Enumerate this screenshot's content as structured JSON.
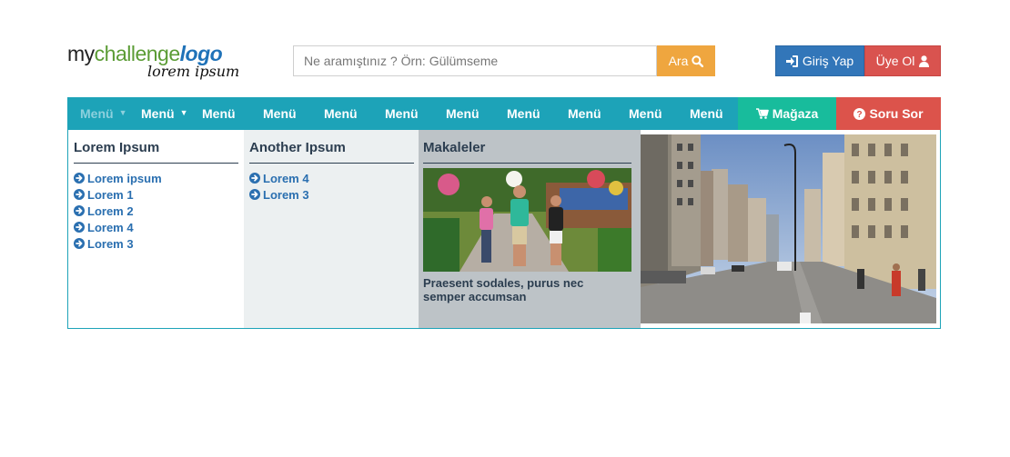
{
  "logo": {
    "part1": "my",
    "part2": "challenge",
    "part3": "logo",
    "tagline": "lorem ipsum"
  },
  "search": {
    "placeholder": "Ne aramıştınız ? Örn: Gülümseme",
    "button_label": "Ara",
    "button_icon": "search-icon"
  },
  "auth": {
    "login_label": "Giriş Yap",
    "login_icon": "sign-in-icon",
    "register_label": "Üye Ol",
    "register_icon": "user-icon"
  },
  "nav": {
    "items": [
      {
        "label": "Menü",
        "caret": true,
        "active": true
      },
      {
        "label": "Menü",
        "caret": true
      },
      {
        "label": "Menü"
      },
      {
        "label": "Menü"
      },
      {
        "label": "Menü"
      },
      {
        "label": "Menü"
      },
      {
        "label": "Menü"
      },
      {
        "label": "Menü"
      },
      {
        "label": "Menü"
      },
      {
        "label": "Menü"
      },
      {
        "label": "Menü"
      }
    ],
    "shop_label": "Mağaza",
    "shop_icon": "cart-icon",
    "ask_label": "Soru Sor",
    "ask_icon": "question-icon"
  },
  "dropdown": {
    "col1": {
      "title": "Lorem Ipsum",
      "links": [
        "Lorem ipsum",
        "Lorem 1",
        "Lorem 2",
        "Lorem 4",
        "Lorem 3"
      ]
    },
    "col2": {
      "title": "Another Ipsum",
      "links": [
        "Lorem 4",
        "Lorem 3"
      ]
    },
    "col3": {
      "title": "Makaleler",
      "caption": "Praesent sodales, purus nec semper accumsan"
    }
  },
  "colors": {
    "nav": "#1da3b8",
    "shop": "#18bc9c",
    "ask": "#dc534b",
    "search_button": "#efa63f",
    "login": "#3276b9",
    "register": "#d9534f",
    "link": "#2a6fb0"
  }
}
